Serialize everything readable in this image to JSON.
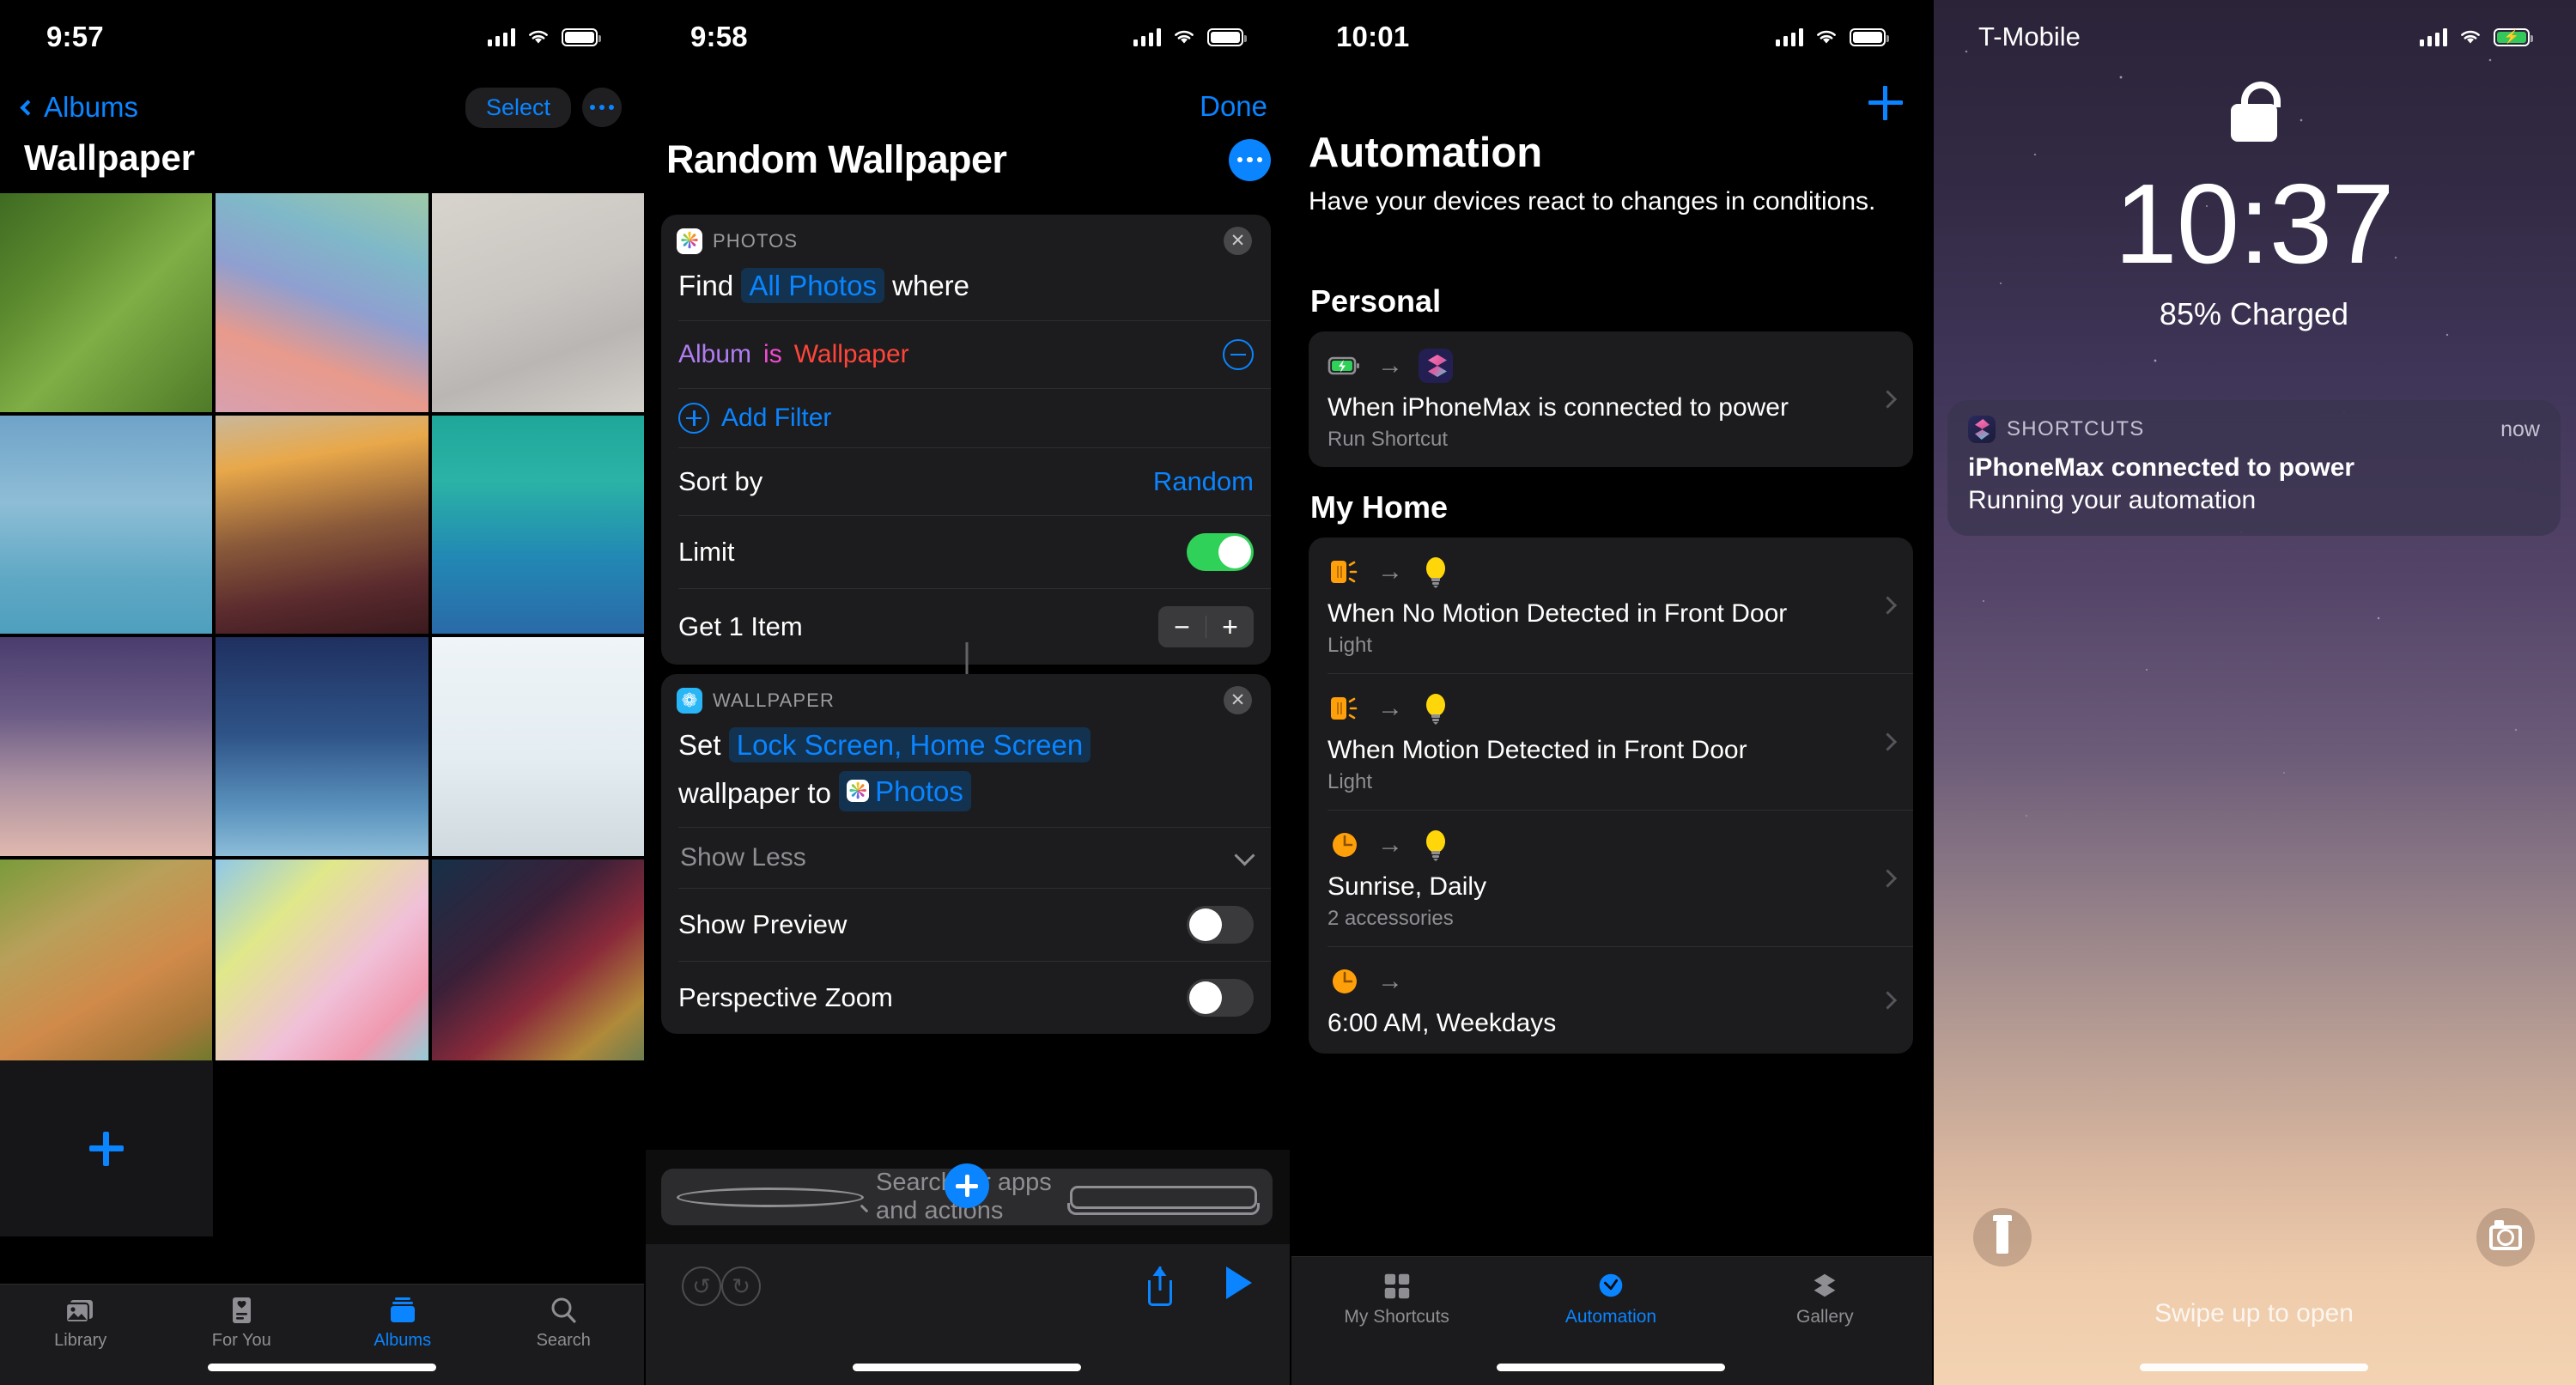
{
  "panel1": {
    "status": {
      "time": "9:57",
      "signal_icon": "cellular-bars-icon",
      "wifi_icon": "wifi-icon",
      "battery_icon": "battery-icon"
    },
    "nav": {
      "back_label": "Albums",
      "select_label": "Select",
      "more_icon": "ellipsis-icon"
    },
    "title": "Wallpaper",
    "photos": [
      {
        "name": "white-pink-flowers",
        "css": "linear-gradient(135deg,#3f6b22 0%,#5c8a2e 30%,#7fae46 55%,#4f7a28 100%)"
      },
      {
        "name": "blurred-rainbow-gradient",
        "css": "linear-gradient(200deg,#9fc9a8 0%,#7fb8c8 25%,#8f9fd0 48%,#e89a8c 72%,#d8a0b0 100%)"
      },
      {
        "name": "blurred-gray-beige",
        "css": "linear-gradient(160deg,#d8d4cd 0%,#c9c6c2 45%,#b9b6b4 70%,#d3cfc9 100%)"
      },
      {
        "name": "blue-frost-texture",
        "css": "linear-gradient(180deg,#6fa3c8 0%,#8ebdd6 40%,#5fa8c4 75%,#4e9fbe 100%)"
      },
      {
        "name": "sunset-through-screen",
        "css": "linear-gradient(170deg,#c9b89a 0%,#e8a84a 22%,#8a5a3a 52%,#5a2a2e 78%,#3a1a1e 100%)"
      },
      {
        "name": "teal-galaxy",
        "css": "linear-gradient(180deg,#1fa79a 0%,#2ab3a6 30%,#2288b4 65%,#2a6aa8 100%)"
      },
      {
        "name": "purple-night-sky",
        "css": "linear-gradient(180deg,#4a3d6e 0%,#6a5a85 35%,#a88fa0 65%,#e0b8ae 100%)"
      },
      {
        "name": "blue-starry-sky",
        "css": "linear-gradient(180deg,#1f3060 0%,#2f5488 45%,#5a92bd 78%,#8cbcd8 100%)"
      },
      {
        "name": "winter-bare-trees",
        "css": "linear-gradient(180deg,#eef4f7 0%,#e4edf2 55%,#cfd9de 100%)"
      },
      {
        "name": "autumn-leaves",
        "css": "linear-gradient(150deg,#7a9b3a 0%,#b8a05a 30%,#d08a4a 58%,#a8783a 80%,#5c7a28 100%)"
      },
      {
        "name": "pastel-gradient",
        "css": "linear-gradient(135deg,#8fc8e8 0%,#e0e88a 28%,#f0c0d8 58%,#f09ab0 78%,#7fd8e0 100%)"
      },
      {
        "name": "dark-warm-blur",
        "css": "linear-gradient(140deg,#163048 0%,#3a2038 35%,#8a2a3a 58%,#b08a3a 80%,#5a7a58 100%)"
      }
    ],
    "add_button_icon": "plus-icon",
    "tabs": [
      {
        "label": "Library",
        "icon": "photos-library-icon",
        "active": false
      },
      {
        "label": "For You",
        "icon": "for-you-icon",
        "active": false
      },
      {
        "label": "Albums",
        "icon": "albums-icon",
        "active": true
      },
      {
        "label": "Search",
        "icon": "search-icon",
        "active": false
      }
    ]
  },
  "panel2": {
    "status": {
      "time": "9:58"
    },
    "done_label": "Done",
    "title": "Random Wallpaper",
    "more_icon": "ellipsis-icon",
    "photos_action": {
      "app_label": "PHOTOS",
      "app_icon": "photos-app-icon",
      "close_icon": "close-icon",
      "line_prefix": "Find",
      "line_token": "All Photos",
      "line_suffix": "where",
      "filter": {
        "key": "Album",
        "op": "is",
        "value": "Wallpaper",
        "remove_icon": "minus-circle-icon"
      },
      "add_filter_label": "Add Filter",
      "add_filter_icon": "plus-circle-icon",
      "sort_label": "Sort by",
      "sort_value": "Random",
      "limit_label": "Limit",
      "limit_on": true,
      "get_label": "Get 1 Item",
      "stepper_minus": "−",
      "stepper_plus": "+"
    },
    "wallpaper_action": {
      "app_label": "WALLPAPER",
      "app_icon": "wallpaper-app-icon",
      "close_icon": "close-icon",
      "line1_prefix": "Set",
      "line1_token": "Lock Screen, Home Screen",
      "line2_prefix": "wallpaper to",
      "line2_token": "Photos",
      "show_less_label": "Show Less",
      "chevron_icon": "chevron-down-icon",
      "show_preview_label": "Show Preview",
      "show_preview_on": false,
      "perspective_zoom_label": "Perspective Zoom",
      "perspective_zoom_on": false
    },
    "add_action_icon": "plus-icon",
    "search": {
      "placeholder": "Search for apps and actions",
      "icon": "search-icon",
      "mic_icon": "microphone-icon"
    },
    "toolbar": {
      "undo_icon": "undo-icon",
      "redo_icon": "redo-icon",
      "share_icon": "share-icon",
      "play_icon": "play-icon"
    }
  },
  "panel3": {
    "status": {
      "time": "10:01"
    },
    "add_icon": "plus-icon",
    "title": "Automation",
    "subtitle": "Have your devices react to changes in conditions.",
    "sections": [
      {
        "heading": "Personal",
        "items": [
          {
            "trigger_icon": "battery-charging-icon",
            "action_icon": "shortcuts-app-icon",
            "title": "When iPhoneMax is connected to power",
            "subtitle": "Run Shortcut",
            "chevron_icon": "chevron-right-icon"
          }
        ]
      },
      {
        "heading": "My Home",
        "items": [
          {
            "trigger_icon": "motion-sensor-icon",
            "action_icon": "lightbulb-icon",
            "title": "When No Motion Detected in Front Door",
            "subtitle": "Light",
            "chevron_icon": "chevron-right-icon"
          },
          {
            "trigger_icon": "motion-sensor-icon",
            "action_icon": "lightbulb-icon",
            "title": "When Motion Detected in Front Door",
            "subtitle": "Light",
            "chevron_icon": "chevron-right-icon"
          },
          {
            "trigger_icon": "clock-icon",
            "action_icon": "lightbulb-icon",
            "title": "Sunrise, Daily",
            "subtitle": "2 accessories",
            "chevron_icon": "chevron-right-icon"
          },
          {
            "trigger_icon": "clock-icon",
            "action_icon": "",
            "title": "6:00 AM, Weekdays",
            "subtitle": "",
            "chevron_icon": "chevron-right-icon"
          }
        ]
      }
    ],
    "tabs": [
      {
        "label": "My Shortcuts",
        "icon": "grid-icon",
        "active": false
      },
      {
        "label": "Automation",
        "icon": "automation-icon",
        "active": true
      },
      {
        "label": "Gallery",
        "icon": "gallery-icon",
        "active": false
      }
    ]
  },
  "panel4": {
    "status": {
      "carrier": "T-Mobile",
      "signal_icon": "cellular-bars-icon",
      "wifi_icon": "wifi-icon",
      "battery_icon": "battery-charging-icon"
    },
    "lock_icon": "unlocked-padlock-icon",
    "clock": "10:37",
    "charge_status": "85% Charged",
    "notification": {
      "app": "SHORTCUTS",
      "app_icon": "shortcuts-app-icon",
      "time": "now",
      "title": "iPhoneMax connected to power",
      "body": "Running your automation"
    },
    "flashlight_icon": "flashlight-icon",
    "camera_icon": "camera-icon",
    "swipe_hint": "Swipe up to open"
  },
  "colors": {
    "accent": "#0a84ff",
    "green": "#30d158",
    "card": "#1c1c1e",
    "secondary_text": "#8e8e93"
  }
}
